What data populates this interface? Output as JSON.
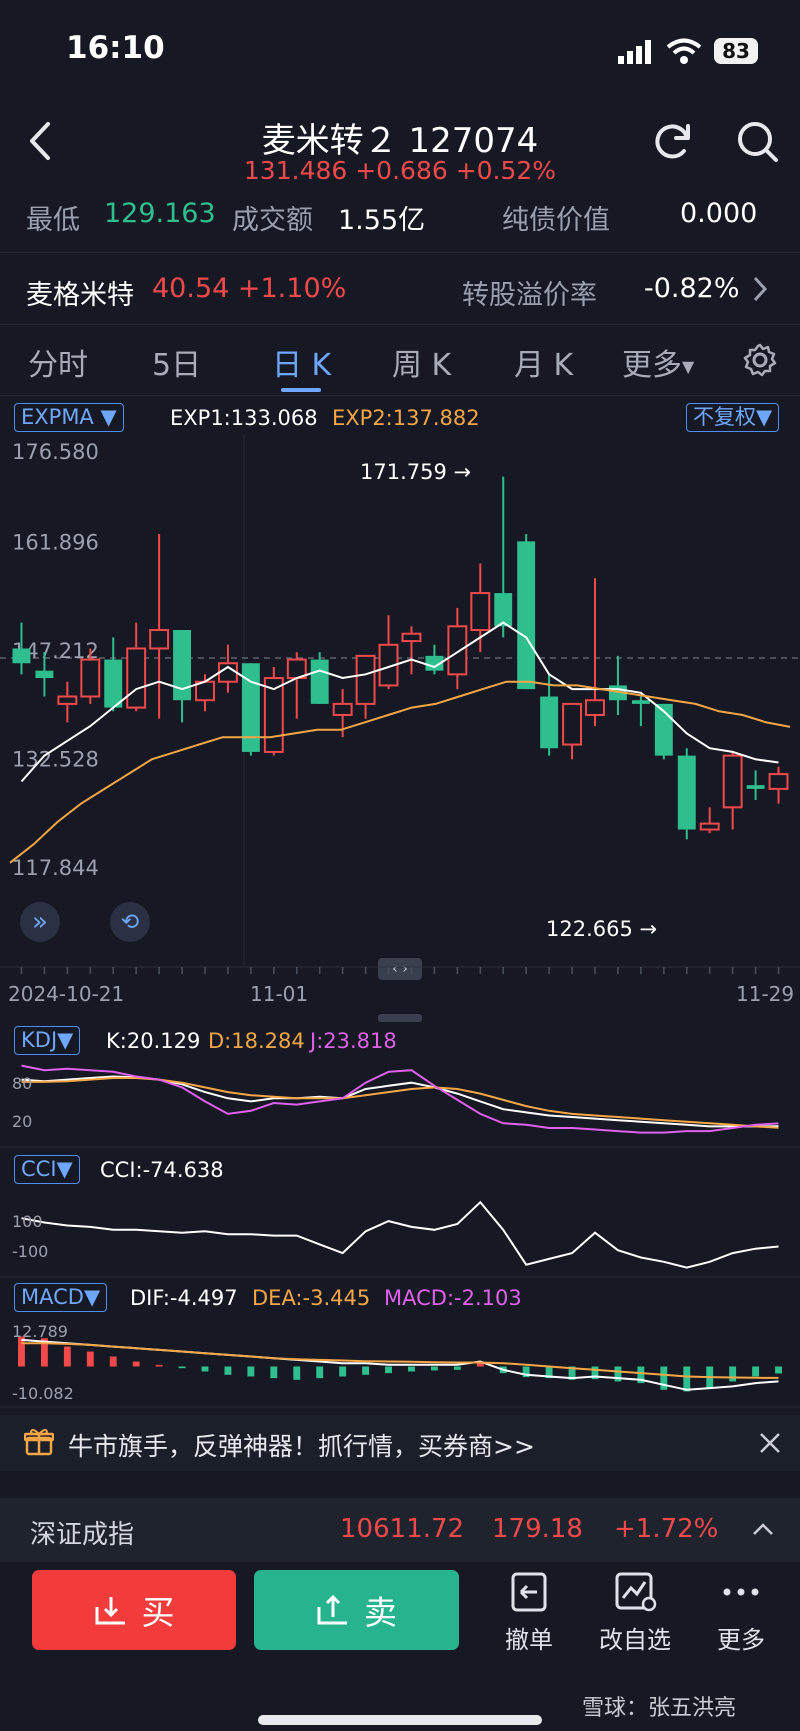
{
  "status_bar": {
    "time": "16:10",
    "battery": "83"
  },
  "header": {
    "title": "麦米转２ 127074",
    "price_line": "131.486 +0.686 +0.52%"
  },
  "stats": {
    "low_label": "最低",
    "low_value": "129.163",
    "turnover_label": "成交额",
    "turnover_value": "1.55亿",
    "bond_value_label": "纯债价值",
    "bond_value": "0.000"
  },
  "underlying": {
    "name": "麦格米特",
    "quote": "40.54 +1.10%",
    "premium_label": "转股溢价率",
    "premium_value": "-0.82%"
  },
  "tabs": [
    "分时",
    "5日",
    "日 K",
    "周 K",
    "月 K",
    "更多"
  ],
  "main_chart": {
    "indicator": "EXPMA",
    "exp1": "EXP1:133.068",
    "exp2": "EXP2:137.882",
    "adjust": "不复权",
    "max_label": "171.759 →",
    "min_label": "122.665 →",
    "dates": [
      "2024-10-21",
      "11-01",
      "11-29"
    ]
  },
  "chart_data": [
    {
      "type": "candlestick",
      "title": "",
      "y_ticks": [
        "176.580",
        "161.896",
        "147.212",
        "132.528",
        "117.844"
      ],
      "ylim": [
        117.844,
        176.58
      ],
      "ohlc": [
        [
          148.5,
          152,
          145,
          146.5
        ],
        [
          145.5,
          148,
          142,
          144.5
        ],
        [
          141,
          144,
          138.5,
          142
        ],
        [
          142,
          148.5,
          141,
          147
        ],
        [
          147,
          150,
          140,
          140.5
        ],
        [
          140.5,
          152,
          140,
          148.5
        ],
        [
          148.5,
          164,
          139,
          151
        ],
        [
          151,
          151,
          138.5,
          141.5
        ],
        [
          141.5,
          145,
          140,
          144
        ],
        [
          144,
          149,
          142.5,
          146.5
        ],
        [
          146.5,
          146.5,
          134,
          134.5
        ],
        [
          134.5,
          146,
          134,
          144.5
        ],
        [
          144.5,
          148,
          139,
          147
        ],
        [
          147,
          148,
          141,
          141
        ],
        [
          139.5,
          143,
          136.5,
          141
        ],
        [
          141,
          147.5,
          139,
          147.5
        ],
        [
          143.5,
          153,
          143,
          149
        ],
        [
          149.5,
          151.5,
          145,
          150.5
        ],
        [
          147.5,
          149,
          145,
          145.5
        ],
        [
          145,
          154,
          143,
          151.5
        ],
        [
          151,
          160,
          148,
          156
        ],
        [
          156,
          171.759,
          150,
          151.5
        ],
        [
          163,
          164,
          143,
          143
        ],
        [
          142,
          145,
          134,
          135
        ],
        [
          135.5,
          141,
          133.5,
          141
        ],
        [
          139.5,
          158,
          138,
          141.5
        ],
        [
          143.5,
          147.5,
          139.5,
          141.5
        ],
        [
          141.5,
          142,
          138,
          141
        ],
        [
          141,
          141,
          133.5,
          134
        ],
        [
          134,
          135,
          122.665,
          124
        ],
        [
          124,
          127,
          123.5,
          124.8
        ],
        [
          127,
          134.5,
          124,
          134
        ],
        [
          130,
          132,
          128,
          129.5
        ],
        [
          129.5,
          132.5,
          127.5,
          131.5
        ]
      ],
      "series": [
        {
          "name": "EXP1",
          "values": [
            130.5,
            134,
            136,
            138,
            140.5,
            143,
            144,
            143,
            144,
            146,
            144,
            143,
            144.5,
            145.5,
            144.5,
            145,
            146,
            147,
            146,
            148,
            150,
            152,
            150,
            145,
            143,
            143,
            143,
            142.5,
            140,
            137,
            135,
            134.5,
            133.5,
            133.068
          ]
        },
        {
          "name": "EXP2",
          "values": [
            119.5,
            122,
            125,
            127.5,
            129.5,
            131.5,
            133.5,
            134.5,
            135.5,
            136.5,
            136.5,
            136.5,
            137,
            137.5,
            137.5,
            138.5,
            139.5,
            140.5,
            141,
            142,
            143,
            144,
            144,
            143.5,
            143.5,
            143,
            142.5,
            142,
            141.5,
            141,
            140,
            139.5,
            138.5,
            137.882
          ]
        }
      ],
      "dashed_line": 147.212
    },
    {
      "type": "line",
      "title": "",
      "indicator": "KDJ",
      "readout": [
        "K:20.129",
        "D:18.284",
        "J:23.818"
      ],
      "y_ticks": [
        "80",
        "20"
      ],
      "ylim": [
        0,
        100
      ],
      "series": [
        {
          "name": "K",
          "values": [
            80,
            78,
            80,
            82,
            84,
            83,
            80,
            74,
            64,
            56,
            52,
            56,
            56,
            58,
            56,
            68,
            72,
            76,
            70,
            62,
            52,
            42,
            38,
            34,
            32,
            30,
            28,
            26,
            24,
            22,
            20,
            20,
            20,
            20.129
          ]
        },
        {
          "name": "D",
          "values": [
            77,
            77,
            78,
            80,
            82,
            82,
            80,
            76,
            70,
            64,
            60,
            58,
            56,
            56,
            56,
            60,
            64,
            68,
            70,
            68,
            62,
            54,
            46,
            40,
            36,
            34,
            32,
            30,
            28,
            26,
            24,
            22,
            20,
            18.284
          ]
        },
        {
          "name": "J",
          "values": [
            98,
            92,
            94,
            92,
            90,
            84,
            80,
            70,
            52,
            36,
            40,
            50,
            48,
            52,
            56,
            76,
            90,
            92,
            72,
            54,
            36,
            24,
            22,
            18,
            18,
            16,
            14,
            12,
            12,
            14,
            14,
            18,
            22,
            23.818
          ]
        }
      ]
    },
    {
      "type": "line",
      "title": "",
      "indicator": "CCI",
      "readout": [
        "CCI:-74.638"
      ],
      "y_ticks": [
        "100",
        "-100"
      ],
      "ylim": [
        -250,
        300
      ],
      "series": [
        {
          "name": "CCI",
          "values": [
            120,
            90,
            70,
            60,
            40,
            40,
            30,
            20,
            30,
            10,
            10,
            0,
            0,
            -60,
            -120,
            30,
            100,
            60,
            40,
            80,
            230,
            40,
            -200,
            -160,
            -120,
            20,
            -100,
            -150,
            -180,
            -220,
            -180,
            -120,
            -90,
            -74.638
          ]
        }
      ]
    },
    {
      "type": "bar",
      "title": "",
      "indicator": "MACD",
      "readout": [
        "DIF:-4.497",
        "DEA:-3.445",
        "MACD:-2.103"
      ],
      "y_ticks": [
        "12.789",
        "-10.082"
      ],
      "ylim": [
        -10.082,
        12.789
      ],
      "values": [
        9,
        8.5,
        6,
        4.5,
        3,
        1.5,
        0.5,
        -0.5,
        -1.5,
        -2.5,
        -3,
        -3.5,
        -4,
        -3.5,
        -3,
        -2.5,
        -2,
        -1.5,
        -1.2,
        -1,
        1.2,
        -2,
        -3.2,
        -3.5,
        -4,
        -3.8,
        -4.5,
        -5,
        -7,
        -7.5,
        -6.5,
        -4.5,
        -3,
        -2.103
      ],
      "series": [
        {
          "name": "DIF",
          "values": [
            8,
            7.5,
            7,
            6.5,
            6,
            5.5,
            5,
            4.5,
            4,
            3.5,
            3,
            2.5,
            2,
            1.5,
            1,
            1,
            0.5,
            0.5,
            0.5,
            0.5,
            1.5,
            -1,
            -2.5,
            -3,
            -3.5,
            -3,
            -3.5,
            -4,
            -5.5,
            -7,
            -6.5,
            -6,
            -5,
            -4.497
          ]
        },
        {
          "name": "DEA",
          "values": [
            7,
            7,
            6.8,
            6.5,
            6,
            5.5,
            5,
            4.5,
            4,
            3.5,
            3,
            2.5,
            2.2,
            2,
            1.8,
            1.6,
            1.5,
            1.4,
            1.3,
            1.2,
            1.2,
            1,
            0.5,
            0,
            -0.5,
            -1,
            -1.5,
            -2,
            -2.5,
            -3,
            -3.2,
            -3.3,
            -3.4,
            -3.445
          ]
        }
      ]
    }
  ],
  "kdj": {
    "label": "KDJ",
    "k": "K:20.129",
    "d": "D:18.284",
    "j": "J:23.818",
    "tick_hi": "80",
    "tick_lo": "20"
  },
  "cci": {
    "label": "CCI",
    "value": "CCI:-74.638",
    "tick_hi": "100",
    "tick_lo": "-100"
  },
  "macd": {
    "label": "MACD",
    "dif": "DIF:-4.497",
    "dea": "DEA:-3.445",
    "macd": "MACD:-2.103",
    "tick_hi": "12.789",
    "tick_lo": "-10.082"
  },
  "banner": {
    "text": "牛市旗手，反弹神器！抓行情，买券商>>"
  },
  "index_bar": {
    "name": "深证成指",
    "value": "10611.72",
    "change": "179.18",
    "pct": "+1.72%"
  },
  "actions": {
    "buy": "买",
    "sell": "卖",
    "cancel": "撤单",
    "edit_watch": "改自选",
    "more": "更多"
  },
  "watermark": "雪球：张五洪亮",
  "colors": {
    "up": "#f2494a",
    "down": "#2fbf8f",
    "exp1": "#ffffff",
    "exp2": "#f7a646",
    "j": "#e060f0",
    "accent": "#6ea7ff"
  }
}
